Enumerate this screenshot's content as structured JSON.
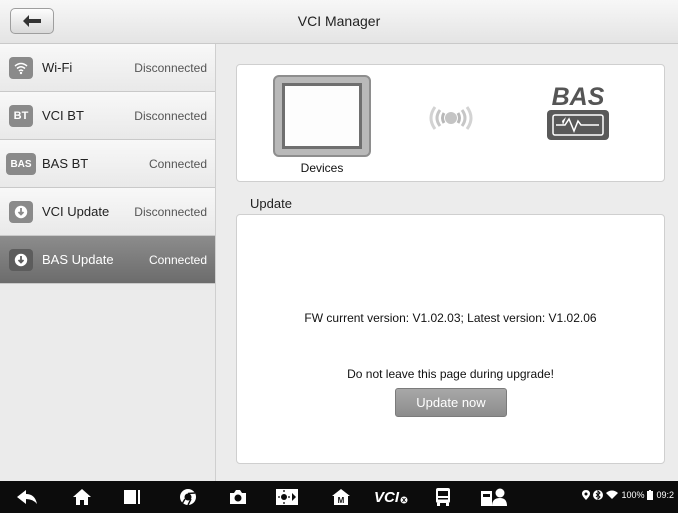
{
  "window": {
    "title": "VCI Manager"
  },
  "sidebar": {
    "items": [
      {
        "label": "Wi-Fi",
        "status": "Disconnected",
        "icon": "wifi-icon",
        "icon_text": "",
        "active": false
      },
      {
        "label": "VCI BT",
        "status": "Disconnected",
        "icon": "bt-icon",
        "icon_text": "BT",
        "active": false
      },
      {
        "label": "BAS BT",
        "status": "Connected",
        "icon": "bas-icon",
        "icon_text": "BAS",
        "active": false
      },
      {
        "label": "VCI Update",
        "status": "Disconnected",
        "icon": "download-icon",
        "icon_text": "",
        "active": false
      },
      {
        "label": "BAS Update",
        "status": "Connected",
        "icon": "download-icon",
        "icon_text": "",
        "active": true
      }
    ]
  },
  "devices": {
    "label": "Devices",
    "logo_text": "BAS"
  },
  "update": {
    "heading": "Update",
    "fw_text": "FW current version: V1.02.03; Latest version: V1.02.06",
    "warning": "Do not leave this page during upgrade!",
    "button_label": "Update now"
  },
  "navbar": {
    "vci_label": "VCI",
    "battery": "100%",
    "time": "09:2"
  },
  "colors": {
    "active_item": "#7a7a7a",
    "button": "#999999",
    "navbar": "#0c0c0c"
  }
}
